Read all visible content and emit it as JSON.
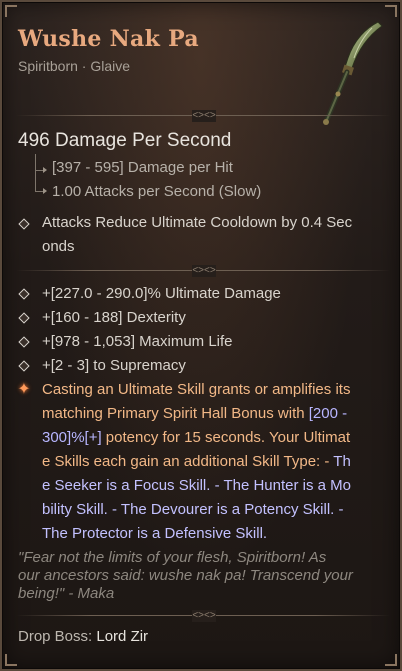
{
  "item": {
    "name": "Wushe Nak Pa",
    "type_line": "Spiritborn · Glaive",
    "icon": "glaive-icon"
  },
  "dps": {
    "headline": "496 Damage Per Second",
    "damage_per_hit": "[397 - 595] Damage per Hit",
    "attack_speed": "1.00 Attacks per Second (Slow)"
  },
  "implicit": {
    "line1": "Attacks Reduce Ultimate Cooldown by 0.4 Sec",
    "line2": "onds"
  },
  "affixes": [
    "+[227.0 - 290.0]% Ultimate Damage",
    "+[160 - 188] Dexterity",
    "+[978 - 1,053] Maximum Life",
    "+[2 - 3] to Supremacy"
  ],
  "legendary_power": {
    "lines": [
      {
        "a": "Casting an Ultimate Skill grants or amplifies its",
        "b": ""
      },
      {
        "a": "matching Primary Spirit Hall Bonus with ",
        "b": "[200 -"
      },
      {
        "a": "",
        "b": "300]%[+]",
        "c": " potency for 15 seconds. Your Ultimat"
      },
      {
        "a": "e Skills each gain an additional Skill Type:  -",
        "b": "  Th"
      },
      {
        "a": "",
        "b": "e Seeker is a Focus Skill.  -  The Hunter is a Mo"
      },
      {
        "a": "",
        "b": "bility Skill.  -  The Devourer is a Potency Skill.  -"
      },
      {
        "a": "",
        "b": " The Protector is a Defensive Skill."
      }
    ]
  },
  "flavor_text": {
    "line1": "\"Fear not the limits of your flesh, Spiritborn!  As",
    "line2": "our ancestors said: wushe nak pa! Transcend your",
    "line3": "being!\" - Maka"
  },
  "drop": {
    "label": "Drop Boss:",
    "boss": "Lord Zir"
  },
  "colors": {
    "title": "#e8a97f",
    "legendary_text": "#f2b887",
    "value_highlight": "#b8b6ff",
    "body_text": "#d9d4cd",
    "flavor": "#8d877f"
  }
}
